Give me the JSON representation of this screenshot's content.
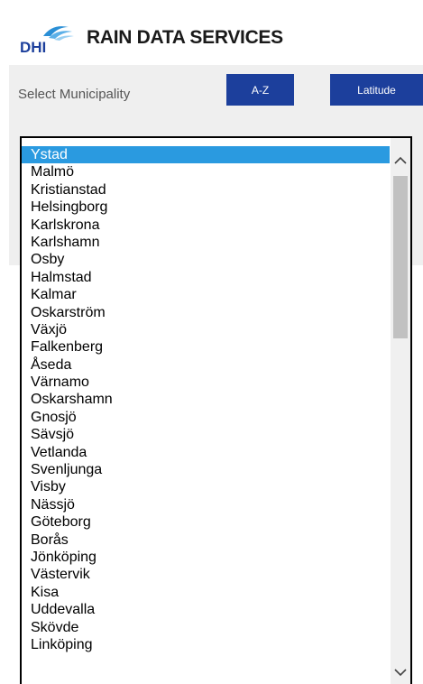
{
  "header": {
    "logo_text": "DHI",
    "brand": "RAIN DATA SERVICES"
  },
  "controls": {
    "select_label": "Select Municipality",
    "sort_az_label": "A-Z",
    "sort_latitude_label": "Latitude"
  },
  "colors": {
    "button": "#1c3f9c",
    "selected": "#2a9ae0",
    "panel": "#efefef"
  },
  "municipalities": {
    "selected": "Ystad",
    "items": [
      "Ystad",
      "Malmö",
      "Kristianstad",
      "Helsingborg",
      "Karlskrona",
      "Karlshamn",
      "Osby",
      "Halmstad",
      "Kalmar",
      "Oskarström",
      "Växjö",
      "Falkenberg",
      "Åseda",
      "Värnamo",
      "Oskarshamn",
      "Gnosjö",
      "Sävsjö",
      "Vetlanda",
      "Svenljunga",
      "Visby",
      "Nässjö",
      "Göteborg",
      "Borås",
      "Jönköping",
      "Västervik",
      "Kisa",
      "Uddevalla",
      "Skövde",
      "Linköping"
    ]
  },
  "icons": {
    "scroll_up": "chevron-up-icon",
    "scroll_down": "chevron-down-icon"
  }
}
